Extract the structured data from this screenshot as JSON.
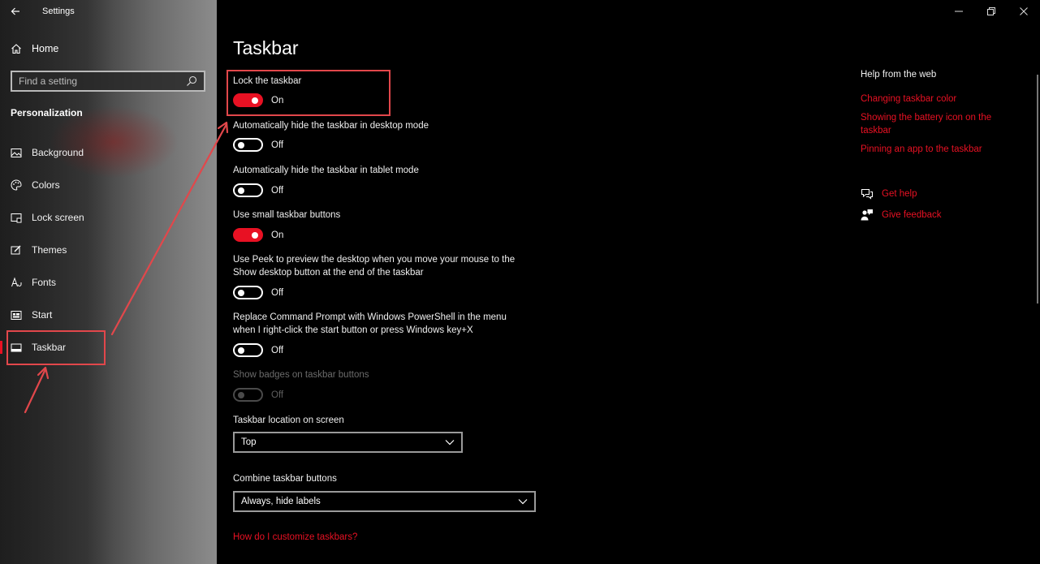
{
  "window": {
    "app_title": "Settings",
    "back_icon": "arrow-left-icon",
    "controls": [
      "minimize-icon",
      "restore-icon",
      "close-icon"
    ]
  },
  "sidebar": {
    "home_label": "Home",
    "search_placeholder": "Find a setting",
    "section_label": "Personalization",
    "items": [
      {
        "label": "Background",
        "icon": "image-icon"
      },
      {
        "label": "Colors",
        "icon": "palette-icon"
      },
      {
        "label": "Lock screen",
        "icon": "lock-screen-icon"
      },
      {
        "label": "Themes",
        "icon": "brush-icon"
      },
      {
        "label": "Fonts",
        "icon": "font-icon"
      },
      {
        "label": "Start",
        "icon": "start-icon"
      },
      {
        "label": "Taskbar",
        "icon": "taskbar-icon",
        "active": true
      }
    ]
  },
  "main": {
    "title": "Taskbar",
    "settings": [
      {
        "label": "Lock the taskbar",
        "state": "On"
      },
      {
        "label": "Automatically hide the taskbar in desktop mode",
        "state": "Off"
      },
      {
        "label": "Automatically hide the taskbar in tablet mode",
        "state": "Off"
      },
      {
        "label": "Use small taskbar buttons",
        "state": "On"
      },
      {
        "label_line1": "Use Peek to preview the desktop when you move your mouse to the",
        "label_line2": "Show desktop button at the end of the taskbar",
        "state": "Off"
      },
      {
        "label_line1": "Replace Command Prompt with Windows PowerShell in the menu",
        "label_line2": "when I right-click the start button or press Windows key+X",
        "state": "Off"
      },
      {
        "label": "Show badges on taskbar buttons",
        "state": "Off",
        "disabled": true
      }
    ],
    "location": {
      "label": "Taskbar location on screen",
      "value": "Top"
    },
    "combine": {
      "label": "Combine taskbar buttons",
      "value": "Always, hide labels"
    },
    "customize_link": "How do I customize taskbars?"
  },
  "help": {
    "title": "Help from the web",
    "links": [
      "Changing taskbar color",
      "Showing the battery icon on the taskbar",
      "Pinning an app to the taskbar"
    ],
    "get_help": "Get help",
    "give_feedback": "Give feedback"
  },
  "colors": {
    "accent": "#e81123",
    "annotation": "#e2474b"
  }
}
